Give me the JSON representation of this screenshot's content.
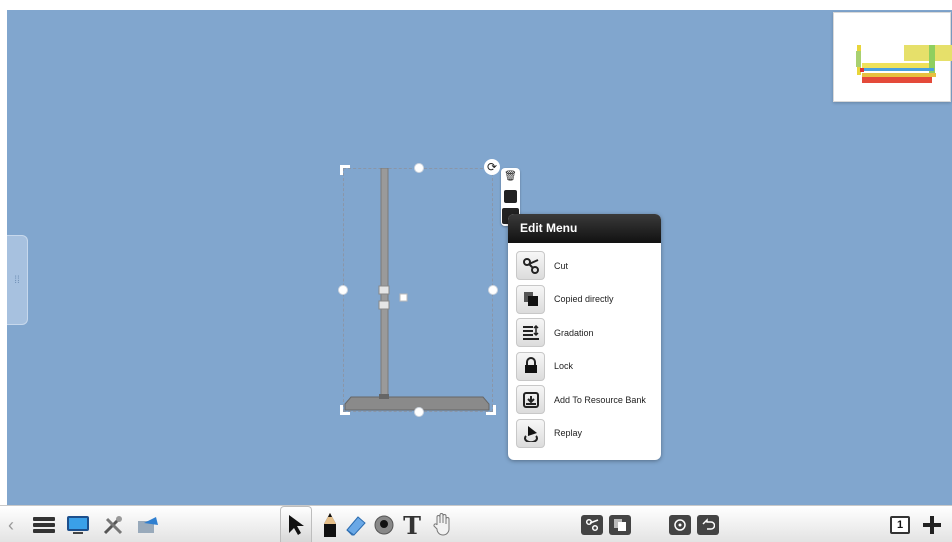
{
  "edit_menu": {
    "title": "Edit Menu",
    "items": [
      {
        "label": "Cut",
        "icon": "scissors-icon"
      },
      {
        "label": "Copied directly",
        "icon": "copy-icon"
      },
      {
        "label": "Gradation",
        "icon": "gradation-icon"
      },
      {
        "label": "Lock",
        "icon": "lock-icon"
      },
      {
        "label": "Add To Resource Bank",
        "icon": "resource-bank-icon"
      },
      {
        "label": "Replay",
        "icon": "replay-icon"
      }
    ]
  },
  "toolbar": {
    "page_number": "1"
  },
  "colors": {
    "canvas": "#81a6ce",
    "menu_header": "#1a1a1a"
  }
}
